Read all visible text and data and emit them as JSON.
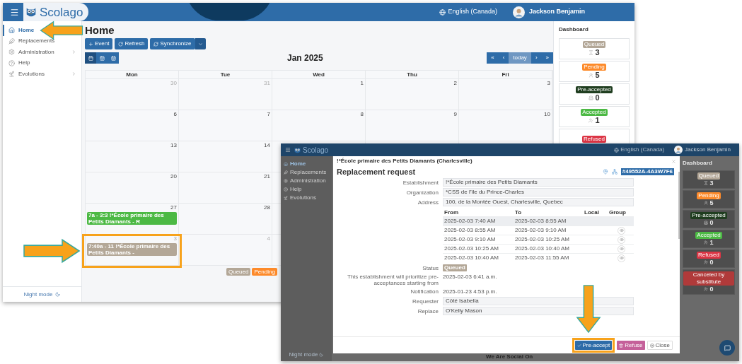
{
  "main_window": {
    "header": {
      "logo": "Scolago",
      "language": "English (Canada)",
      "user": "Jackson Benjamin"
    },
    "sidebar": {
      "items": [
        {
          "kind": "home",
          "label": "Home",
          "selected": true,
          "expandable": false
        },
        {
          "kind": "replacements",
          "label": "Replacements",
          "selected": false,
          "expandable": false
        },
        {
          "kind": "administration",
          "label": "Administration",
          "selected": false,
          "expandable": true
        },
        {
          "kind": "help",
          "label": "Help",
          "selected": false,
          "expandable": false
        },
        {
          "kind": "evolutions",
          "label": "Evolutions",
          "selected": false,
          "expandable": true
        }
      ],
      "night_mode": "Night mode"
    },
    "page_title": "Home",
    "toolbar": [
      {
        "kind": "add",
        "label": "Event"
      },
      {
        "kind": "refresh",
        "label": "Refresh"
      },
      {
        "kind": "sync",
        "label": "Synchronize"
      }
    ],
    "view_buttons": [
      {
        "kind": "month",
        "selected": true
      },
      {
        "kind": "week",
        "selected": false
      },
      {
        "kind": "day",
        "selected": false
      }
    ],
    "calendar": {
      "title": "Jan 2025",
      "nav": [
        {
          "label": "«",
          "disabled": false
        },
        {
          "label": "‹",
          "disabled": false
        },
        {
          "label": "today",
          "disabled": true
        },
        {
          "label": "›",
          "disabled": false
        },
        {
          "label": "»",
          "disabled": false
        }
      ],
      "weekdays": [
        "Mon",
        "Tue",
        "Wed",
        "Thu",
        "Fri"
      ],
      "weeks": [
        {
          "days": [
            {
              "number": "30",
              "muted": true
            },
            {
              "number": "31",
              "muted": true
            },
            {
              "number": "1",
              "muted": false
            },
            {
              "number": "2",
              "muted": false
            },
            {
              "number": "3",
              "muted": false
            }
          ]
        },
        {
          "days": [
            {
              "number": "6",
              "muted": false
            },
            {
              "number": "7",
              "muted": false
            },
            {
              "number": "8",
              "muted": false
            },
            {
              "number": "9",
              "muted": false
            },
            {
              "number": "10",
              "muted": false
            }
          ]
        },
        {
          "days": [
            {
              "number": "13",
              "muted": false
            },
            {
              "number": "14",
              "muted": false
            }
          ]
        },
        {
          "days": [
            {
              "number": "20",
              "muted": false
            },
            {
              "number": "21",
              "muted": false
            }
          ]
        },
        {
          "days": [
            {
              "number": "27",
              "muted": false,
              "events": [
                {
                  "label": "7a - 3:3 !*École primaire des Petits Diamants - R",
                  "color": "#4cb944"
                }
              ]
            },
            {
              "number": "28",
              "muted": false
            }
          ]
        },
        {
          "days": [
            {
              "number": "3",
              "muted": true,
              "events": [
                {
                  "label": "7:40a - 11 !*École primaire des Petits Diamants -",
                  "color": "#b3a797"
                }
              ]
            },
            {
              "number": "4",
              "muted": true
            }
          ]
        }
      ],
      "legend": [
        {
          "label": "Queued",
          "color": "#b3a797"
        },
        {
          "label": "Pending",
          "color": "#fd8a2a"
        }
      ]
    },
    "dashboard": {
      "title": "Dashboard",
      "cards": [
        {
          "kind": "queued",
          "label": "Queued",
          "color": "#b3a797",
          "count": "3"
        },
        {
          "kind": "pending",
          "label": "Pending",
          "color": "#fd8a2a",
          "count": "5"
        },
        {
          "kind": "preaccepted",
          "label": "Pre-accepted",
          "color": "#1f3d1f",
          "count": "0"
        },
        {
          "kind": "accepted",
          "label": "Accepted",
          "color": "#4cb944",
          "count": "1"
        },
        {
          "kind": "refused",
          "label": "Refused",
          "color": "#dc3545"
        }
      ]
    }
  },
  "popup_window": {
    "header": {
      "logo": "Scolago",
      "language": "English (Canada)",
      "user": "Jackson Benjamin"
    },
    "sidebar": {
      "items": [
        {
          "kind": "home",
          "label": "Home",
          "selected": true
        },
        {
          "kind": "replacements",
          "label": "Replacements",
          "selected": false
        },
        {
          "kind": "administration",
          "label": "Administration",
          "selected": false
        },
        {
          "kind": "help",
          "label": "Help",
          "selected": false
        },
        {
          "kind": "evolutions",
          "label": "Evolutions",
          "selected": false
        }
      ],
      "night_mode": "Night mode"
    },
    "dashboard": {
      "title": "Dashboard",
      "cards": [
        {
          "kind": "queued",
          "label": "Queued",
          "color": "#b3a797",
          "count": "3"
        },
        {
          "kind": "pending",
          "label": "Pending",
          "color": "#fd8a2a",
          "count": "5"
        },
        {
          "kind": "preaccepted",
          "label": "Pre-accepted",
          "color": "#1f3d1f",
          "count": "0"
        },
        {
          "kind": "accepted",
          "label": "Accepted",
          "color": "#4cb944",
          "count": "1"
        },
        {
          "kind": "refused",
          "label": "Refused",
          "color": "#dc3545",
          "count": "0"
        },
        {
          "kind": "canceled",
          "label": "Canceled by substitute",
          "color": "#b03a3a",
          "count": "0"
        }
      ]
    },
    "footer_text": "We Are Social On",
    "modal": {
      "school": "!*École primaire des Petits Diamants (Charlesville)",
      "title": "Replacement request",
      "reference": "#49552A-4A3W7F6",
      "fields": [
        {
          "label": "Establishment",
          "value": "!*École primaire des Petits Diamants"
        },
        {
          "label": "Organization",
          "value": "*CSS de l'île du Prince-Charles"
        },
        {
          "label": "Address",
          "value": "100, de la Montée Ouest, Charlesville, Quebec"
        }
      ],
      "periods": {
        "columns": [
          "From",
          "To",
          "Local",
          "Group"
        ],
        "rows": [
          {
            "from": "2025-02-03 7:40 AM",
            "to": "2025-02-03 8:55 AM",
            "highlighted": true,
            "view_button": false
          },
          {
            "from": "2025-02-03 8:55 AM",
            "to": "2025-02-03 9:10 AM",
            "highlighted": false,
            "view_button": true
          },
          {
            "from": "2025-02-03 9:10 AM",
            "to": "2025-02-03 10:25 AM",
            "highlighted": false,
            "view_button": true
          },
          {
            "from": "2025-02-03 10:25 AM",
            "to": "2025-02-03 10:40 AM",
            "highlighted": false,
            "view_button": true
          },
          {
            "from": "2025-02-03 10:40 AM",
            "to": "2025-02-03 11:55 AM",
            "highlighted": false,
            "view_button": true
          }
        ]
      },
      "status": {
        "label": "Status",
        "value": "Queued",
        "color": "#b3a797"
      },
      "info": [
        {
          "label": "This establishment will prioritize pre-acceptances starting from",
          "value": "2025-02-03 6:41 a.m."
        },
        {
          "label": "Notification",
          "value": "2025-01-23 4:53 p.m."
        }
      ],
      "people": [
        {
          "label": "Requester",
          "value": "Côté Isabella"
        },
        {
          "label": "Replace",
          "value": "O'Kelly Mason"
        }
      ],
      "buttons": [
        {
          "kind": "primary",
          "label": "Pre-accept",
          "highlighted": true
        },
        {
          "kind": "danger",
          "label": "Refuse",
          "highlighted": false
        },
        {
          "kind": "default",
          "label": "Close",
          "highlighted": false
        }
      ]
    }
  }
}
